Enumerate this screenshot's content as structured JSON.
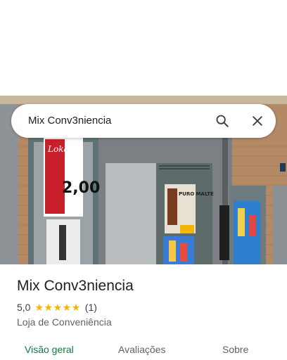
{
  "search": {
    "query": "Mix Conv3niencia",
    "search_icon": "search-icon",
    "close_icon": "close-icon"
  },
  "place": {
    "name": "Mix Conv3niencia",
    "rating": "5,0",
    "stars": 5,
    "review_count": "(1)",
    "category": "Loja de Conveniência"
  },
  "photo": {
    "sign_brand": "Lokal",
    "sign_price": "2,00",
    "poster_text": "PURO MALTE"
  },
  "tabs": [
    {
      "label": "Visão geral",
      "active": true
    },
    {
      "label": "Avaliações",
      "active": false
    },
    {
      "label": "Sobre",
      "active": false
    }
  ],
  "colors": {
    "accent": "#0b8043",
    "star": "#f6b400",
    "text_primary": "#202124",
    "text_secondary": "#5f6368"
  }
}
